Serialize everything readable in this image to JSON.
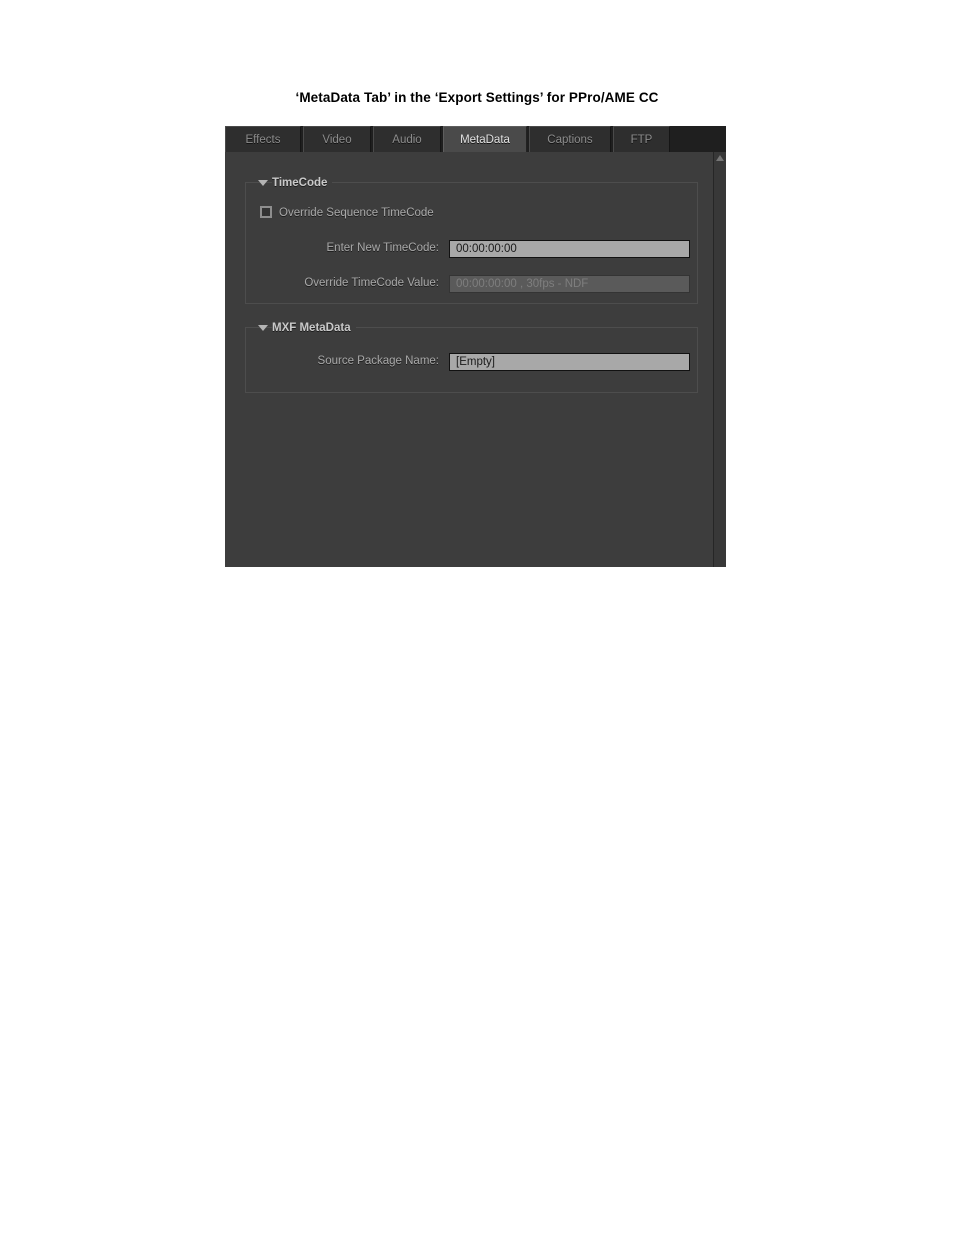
{
  "document": {
    "title": "‘MetaData Tab’ in the ‘Export Settings’ for PPro/AME CC"
  },
  "panel": {
    "name": "Export Settings",
    "background_color": "#3d3d3d",
    "tabs": [
      {
        "label": "Effects",
        "active": false
      },
      {
        "label": "Video",
        "active": false
      },
      {
        "label": "Audio",
        "active": false
      },
      {
        "label": "MetaData",
        "active": true
      },
      {
        "label": "Captions",
        "active": false
      },
      {
        "label": "FTP",
        "active": false
      }
    ],
    "active_tab": "MetaData",
    "scrollbar": {
      "up_arrow_icon": "triangle-up-icon"
    }
  },
  "groups": [
    {
      "title": "TimeCode",
      "twisty_icon": "triangle-down-icon",
      "expanded": true,
      "checkbox": {
        "label": "Override Sequence TimeCode",
        "checked": false
      },
      "fields": [
        {
          "label": "Enter New TimeCode:",
          "value": "00:00:00:00",
          "disabled": false
        },
        {
          "label": "Override TimeCode Value:",
          "value": "00:00:00:00 , 30fps - NDF",
          "disabled": true
        }
      ]
    },
    {
      "title": "MXF MetaData",
      "twisty_icon": "triangle-down-icon",
      "expanded": true,
      "fields": [
        {
          "label": "Source Package Name:",
          "value": "[Empty]",
          "disabled": false
        }
      ]
    }
  ]
}
